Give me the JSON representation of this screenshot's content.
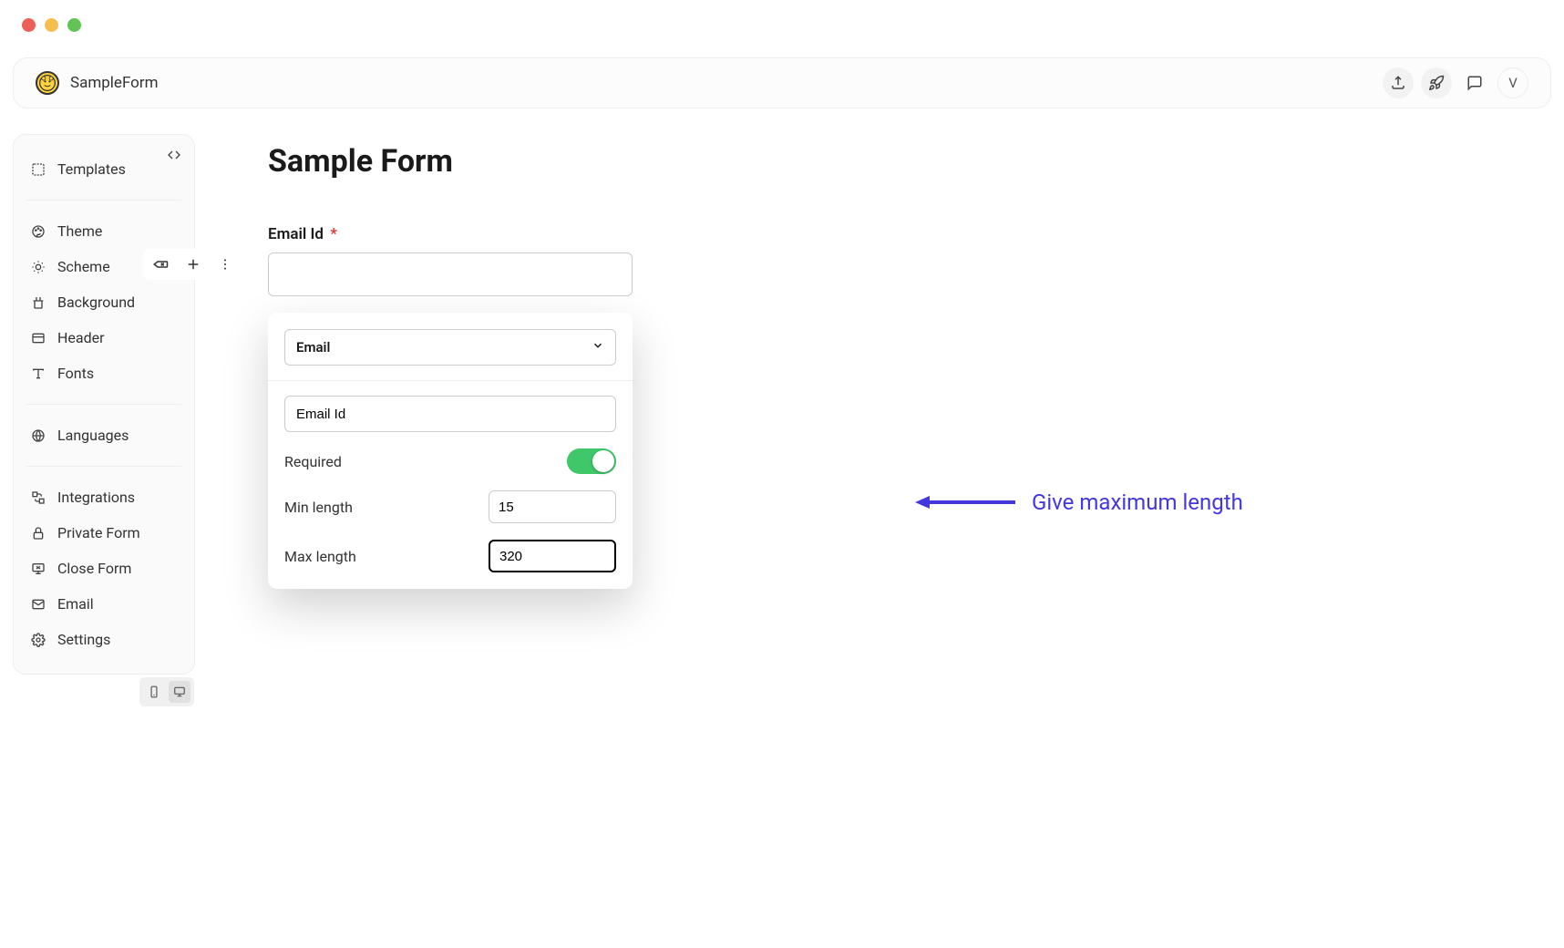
{
  "window": {
    "title": "SampleForm"
  },
  "topbar": {
    "user_initial": "V"
  },
  "sidebar": {
    "items": [
      {
        "key": "templates",
        "label": "Templates"
      },
      {
        "key": "theme",
        "label": "Theme"
      },
      {
        "key": "scheme",
        "label": "Scheme"
      },
      {
        "key": "background",
        "label": "Background"
      },
      {
        "key": "header",
        "label": "Header"
      },
      {
        "key": "fonts",
        "label": "Fonts"
      },
      {
        "key": "languages",
        "label": "Languages"
      },
      {
        "key": "integrations",
        "label": "Integrations"
      },
      {
        "key": "private_form",
        "label": "Private Form"
      },
      {
        "key": "close_form",
        "label": "Close Form"
      },
      {
        "key": "email",
        "label": "Email"
      },
      {
        "key": "settings",
        "label": "Settings"
      }
    ]
  },
  "form": {
    "title": "Sample Form",
    "field_label": "Email Id",
    "field_value": ""
  },
  "popover": {
    "type_selected": "Email",
    "label_value": "Email Id",
    "required_label": "Required",
    "required": true,
    "min_length_label": "Min length",
    "min_length_value": "15",
    "max_length_label": "Max length",
    "max_length_value": "320"
  },
  "annotation": {
    "text": "Give maximum length"
  }
}
